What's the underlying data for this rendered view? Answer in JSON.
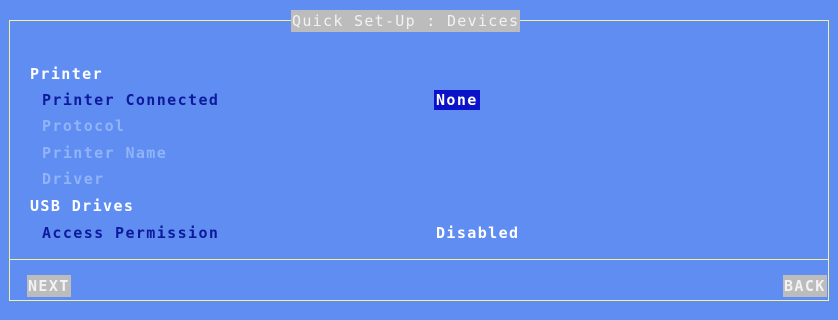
{
  "window": {
    "title": "Quick Set-Up : Devices"
  },
  "sections": {
    "printer": {
      "label": "Printer",
      "items": [
        {
          "label": "Printer Connected",
          "value": "None",
          "state": "active"
        },
        {
          "label": "Protocol",
          "state": "disabled"
        },
        {
          "label": "Printer Name",
          "state": "disabled"
        },
        {
          "label": "Driver",
          "state": "disabled"
        }
      ]
    },
    "usb": {
      "label": "USB Drives",
      "items": [
        {
          "label": "Access Permission",
          "value": "Disabled",
          "state": "active"
        }
      ]
    }
  },
  "footer": {
    "next_label": "NEXT",
    "back_label": "BACK"
  },
  "colors": {
    "background": "#5f8df2",
    "frame": "#f2f2a0",
    "active_text": "#0e1a9b",
    "disabled_text": "#90b4f7",
    "selection": "#0c12c8"
  }
}
